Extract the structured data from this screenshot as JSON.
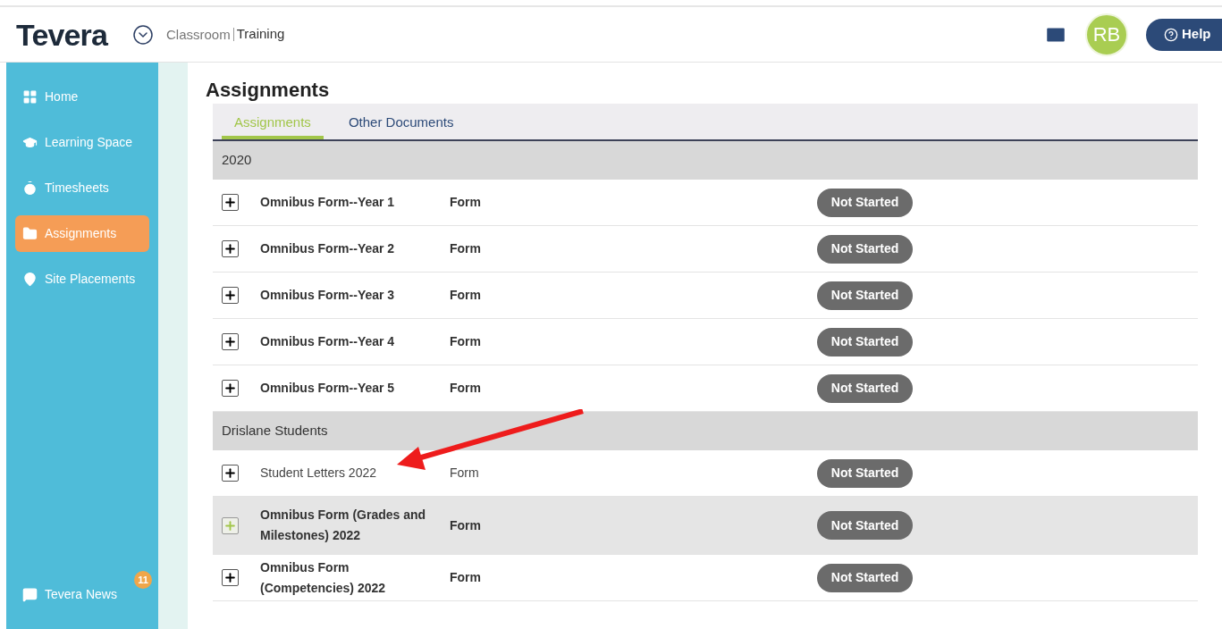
{
  "header": {
    "logo": "Tevera",
    "breadcrumb_parent": "Classroom",
    "breadcrumb_current": "Training",
    "avatar": "RB",
    "help": "Help"
  },
  "sidebar": {
    "items": [
      {
        "label": "Home",
        "selected": false
      },
      {
        "label": "Learning Space",
        "selected": false
      },
      {
        "label": "Timesheets",
        "selected": false
      },
      {
        "label": "Assignments",
        "selected": true
      },
      {
        "label": "Site Placements",
        "selected": false
      }
    ],
    "news": {
      "label": "Tevera News",
      "count": "11"
    }
  },
  "page_title": "Assignments",
  "tabs": [
    {
      "label": "Assignments",
      "selected": true
    },
    {
      "label": "Other Documents",
      "selected": false
    }
  ],
  "groups": [
    {
      "title": "2020",
      "rows": [
        {
          "name": "Omnibus Form--Year 1",
          "type": "Form",
          "status": "Not Started",
          "unread": true,
          "hovered": false
        },
        {
          "name": "Omnibus Form--Year 2",
          "type": "Form",
          "status": "Not Started",
          "unread": true,
          "hovered": false
        },
        {
          "name": "Omnibus Form--Year 3",
          "type": "Form",
          "status": "Not Started",
          "unread": true,
          "hovered": false
        },
        {
          "name": "Omnibus Form--Year 4",
          "type": "Form",
          "status": "Not Started",
          "unread": true,
          "hovered": false
        },
        {
          "name": "Omnibus Form--Year 5",
          "type": "Form",
          "status": "Not Started",
          "unread": true,
          "hovered": false
        }
      ]
    },
    {
      "title": "Drislane Students",
      "rows": [
        {
          "name": "Student Letters 2022",
          "type": "Form",
          "status": "Not Started",
          "unread": false,
          "hovered": false
        },
        {
          "name": "Omnibus Form (Grades and Milestones) 2022",
          "type": "Form",
          "status": "Not Started",
          "unread": true,
          "hovered": true
        },
        {
          "name": "Omnibus Form (Competencies) 2022",
          "type": "Form",
          "status": "Not Started",
          "unread": true,
          "hovered": false
        }
      ]
    }
  ]
}
